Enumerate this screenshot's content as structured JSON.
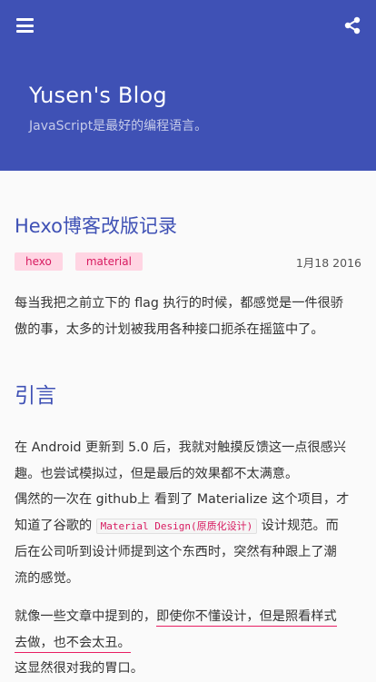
{
  "header": {
    "menu_icon": "hamburger-menu-icon",
    "share_icon": "share-icon",
    "blog_title": "Yusen's Blog",
    "blog_subtitle": "JavaScript是最好的编程语言。",
    "color": "#3f51b5"
  },
  "post": {
    "title": "Hexo博客改版记录",
    "tags": [
      "hexo",
      "material"
    ],
    "date": "1月18 2016",
    "intro_line1": "每当我把之前立下的 flag 执行的时候，都感觉是一件很骄",
    "intro_line2": "傲的事，太多的计划被我用各种接口扼杀在摇篮中了。",
    "section_heading": "引言",
    "p2_line1": "在 Android 更新到 5.0 后，我就对触摸反馈这一点很感兴",
    "p2_line2": "趣。也尝试模拟过，但是最后的效果都不太满意。",
    "p2_line3": "偶然的一次在 github上 看到了 Materialize 这个项目，才",
    "p2_line4_before": "知道了谷歌的 ",
    "p2_code": "Material Design(原质化设计)",
    "p2_line4_after": " 设计规范。而",
    "p2_line5": "后在公司听到设计师提到这个东西时，突然有种跟上了潮",
    "p2_line6": "流的感觉。",
    "p3_line1_before": "就像一些文章中提到的，",
    "p3_line1_underlined": "即使你不懂设计，但是照看样式",
    "p3_line2_underlined": "去做，也不会太丑。",
    "p3_line3": "这显然很对我的胃口。"
  }
}
